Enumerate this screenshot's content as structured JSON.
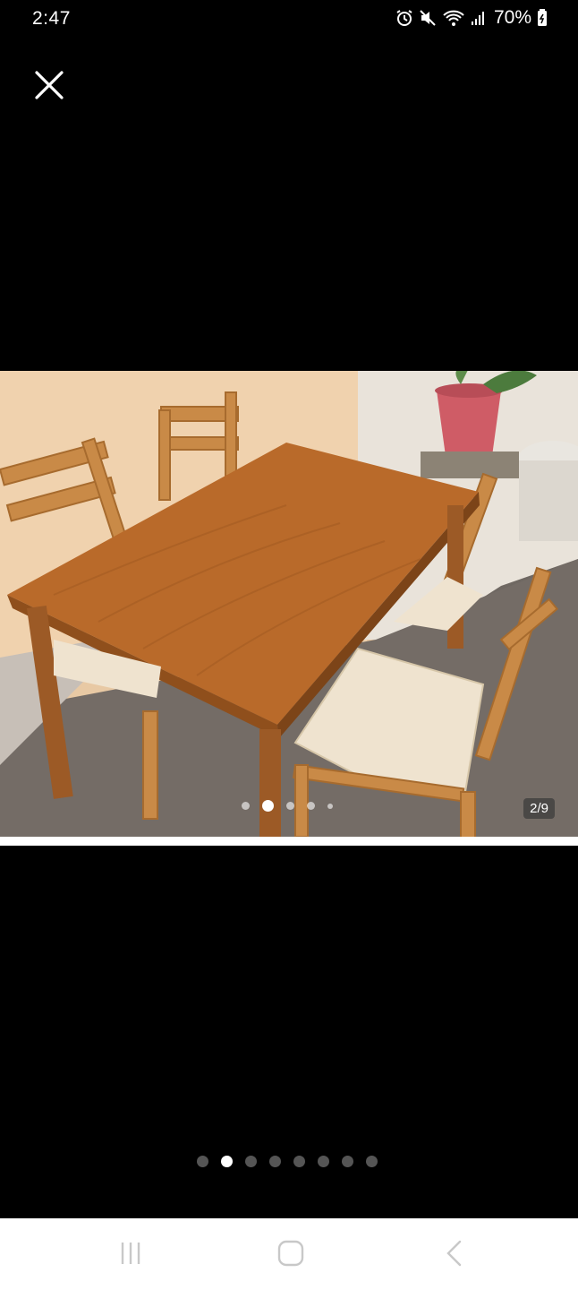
{
  "status_bar": {
    "time": "2:47",
    "battery_percent": "70%",
    "icons": [
      "alarm-icon",
      "mute-icon",
      "wifi-icon",
      "signal-icon",
      "battery-icon"
    ]
  },
  "viewer": {
    "close_icon": "close-icon",
    "photo_counter": "2/9",
    "photo_dots": {
      "count": 5,
      "active_index": 1
    },
    "page_dots": {
      "count": 8,
      "active_index": 1
    },
    "photo_description_icon": "dining-table-photo"
  },
  "nav_bar": {
    "icons": [
      "recent-apps-icon",
      "home-icon",
      "back-icon"
    ]
  }
}
